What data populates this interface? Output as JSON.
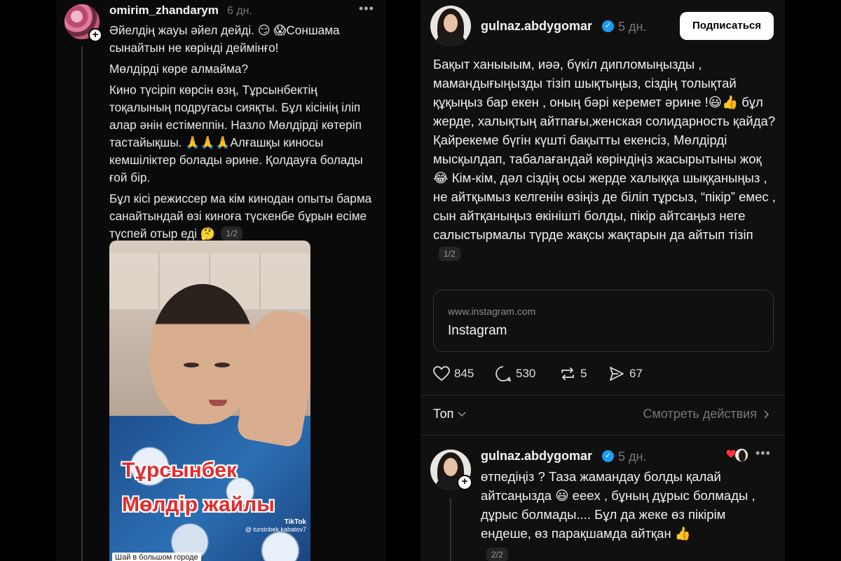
{
  "left_post": {
    "username": "omirim_zhandarym",
    "time": "6 дн.",
    "paragraphs": [
      "Әйелдің жауы әйел дейді. 😏 😱Соншама сынайтын не көрінді деймінғо!",
      "Мөлдірді көре алмайма?",
      "Кино түсіріп көрсін өзң, Тұрсынбектің тоқалының подругасы сияқты. Бұл кісінің іліп алар әнін естімеппін. Назло  Мөлдірді көтеріп тастайықшы. 🙏🙏🙏Алғашқы киносы кемшіліктер болады әрине. Қолдауға болады ғой бір.",
      "Бұл кісі режиссер ма кім кинодан опыты барма санайтындай өзі киноға түскенбе бұрын есіме түспей отыр еді 🤔"
    ],
    "pager": "1/2",
    "video": {
      "title_line1": "Тұрсынбек",
      "title_line2": "Мөлдір  жайлы",
      "watermark_brand": "TikTok",
      "watermark_handle": "@ tursinbek.kabatov7",
      "caption": "Шай в большом городе"
    }
  },
  "right_post": {
    "username": "gulnaz.abdygomar",
    "time": "5 дн.",
    "subscribe_label": "Подписаться",
    "text": "Бақыт ханыыым, иәә, бүкіл дипломыңызды , мамандығыңызды тізіп шықтыңыз, сіздің толықтай құқыңыз бар  екен , оның бәрі керемет әрине !😃👍 бұл жерде, халықтың айтпағы,женская солидарность қайда?Қайрекеме бүгін күшті бақытты екенсіз, Мөлдірді мысқылдап, табалағандай көріндіңіз жасырытыны жоқ😂 Кім-кім, дәл сіздің осы жерде халыққа шыққаныңыз , не айтқымыз келгенін өзіңіз де біліп тұрсыз, “пікір” емес , сын айтқаныңыз өкінішті болды, пікір айтсаңыз неге салыстырмалы түрде жақсы жақтарын да айтып тізіп",
    "pager": "1/2",
    "link": {
      "domain": "www.instagram.com",
      "title": "Instagram"
    },
    "actions": {
      "likes": "845",
      "comments": "530",
      "reposts": "5",
      "shares": "67"
    },
    "sort_label": "Топ",
    "activity_label": "Смотреть действия"
  },
  "reply": {
    "username": "gulnaz.abdygomar",
    "time": "5 дн.",
    "text": "өтпедіңіз ? Таза жамандау болды қалай айтсаңызда 😃  еeex , бұның дұрыс болмады , дұрыс болмады.... Бұл да жеке өз пікірім ендеше, өз парақшамда айтқан 👍",
    "pager": "2/2"
  },
  "colors": {
    "background": "#000000",
    "verified": "#1d9bf0",
    "heart": "#ff3040",
    "title_red": "#e32b2b"
  }
}
